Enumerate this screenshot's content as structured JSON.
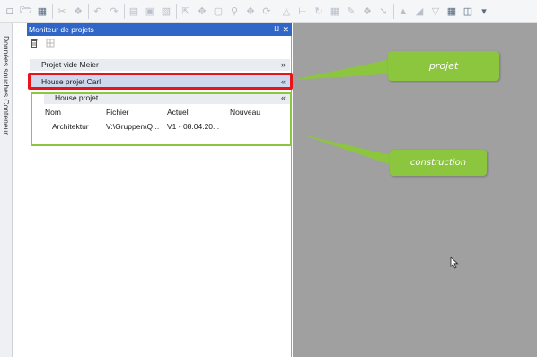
{
  "panel": {
    "title": "Moniteur de projets",
    "pin_glyph": "⨿",
    "close_glyph": "✕"
  },
  "side_tab": {
    "label": "Données souches Conteneur"
  },
  "projects": [
    {
      "name": "Projet vide Meier",
      "chevron": "»"
    },
    {
      "name": "House projet Carl",
      "chevron": "«"
    }
  ],
  "subproject": {
    "name": "House projet",
    "chevron": "«"
  },
  "table": {
    "headers": [
      "Nom",
      "Fichier",
      "Actuel",
      "Nouveau"
    ],
    "rows": [
      {
        "nom": "Architektur",
        "fichier": "V:\\Gruppen\\Q...",
        "actuel": "V1 - 08.04.20...",
        "nouveau": ""
      }
    ]
  },
  "callouts": {
    "projet": "projet",
    "construction": "construction"
  },
  "colors": {
    "accent_title": "#2f66c8",
    "callout_green": "#8cc63f",
    "highlight_red": "#e8141b",
    "canvas_gray": "#a0a0a0"
  },
  "toolbar_icons": [
    "new-icon",
    "open-icon",
    "save-icon",
    "cut-icon",
    "copy-icon",
    "undo-icon",
    "redo-icon",
    "print-icon",
    "layer-icon",
    "clipboard-icon",
    "select-icon",
    "move-icon",
    "window-icon",
    "zoom-icon",
    "pan-icon",
    "redraw-icon",
    "pen-icon",
    "dimension-icon",
    "rotate-icon",
    "grid-icon",
    "pencil-icon",
    "snap-icon",
    "measure-icon",
    "render-icon",
    "analysis-icon",
    "filter-icon",
    "calculator-icon",
    "view-icon",
    "more-icon"
  ]
}
